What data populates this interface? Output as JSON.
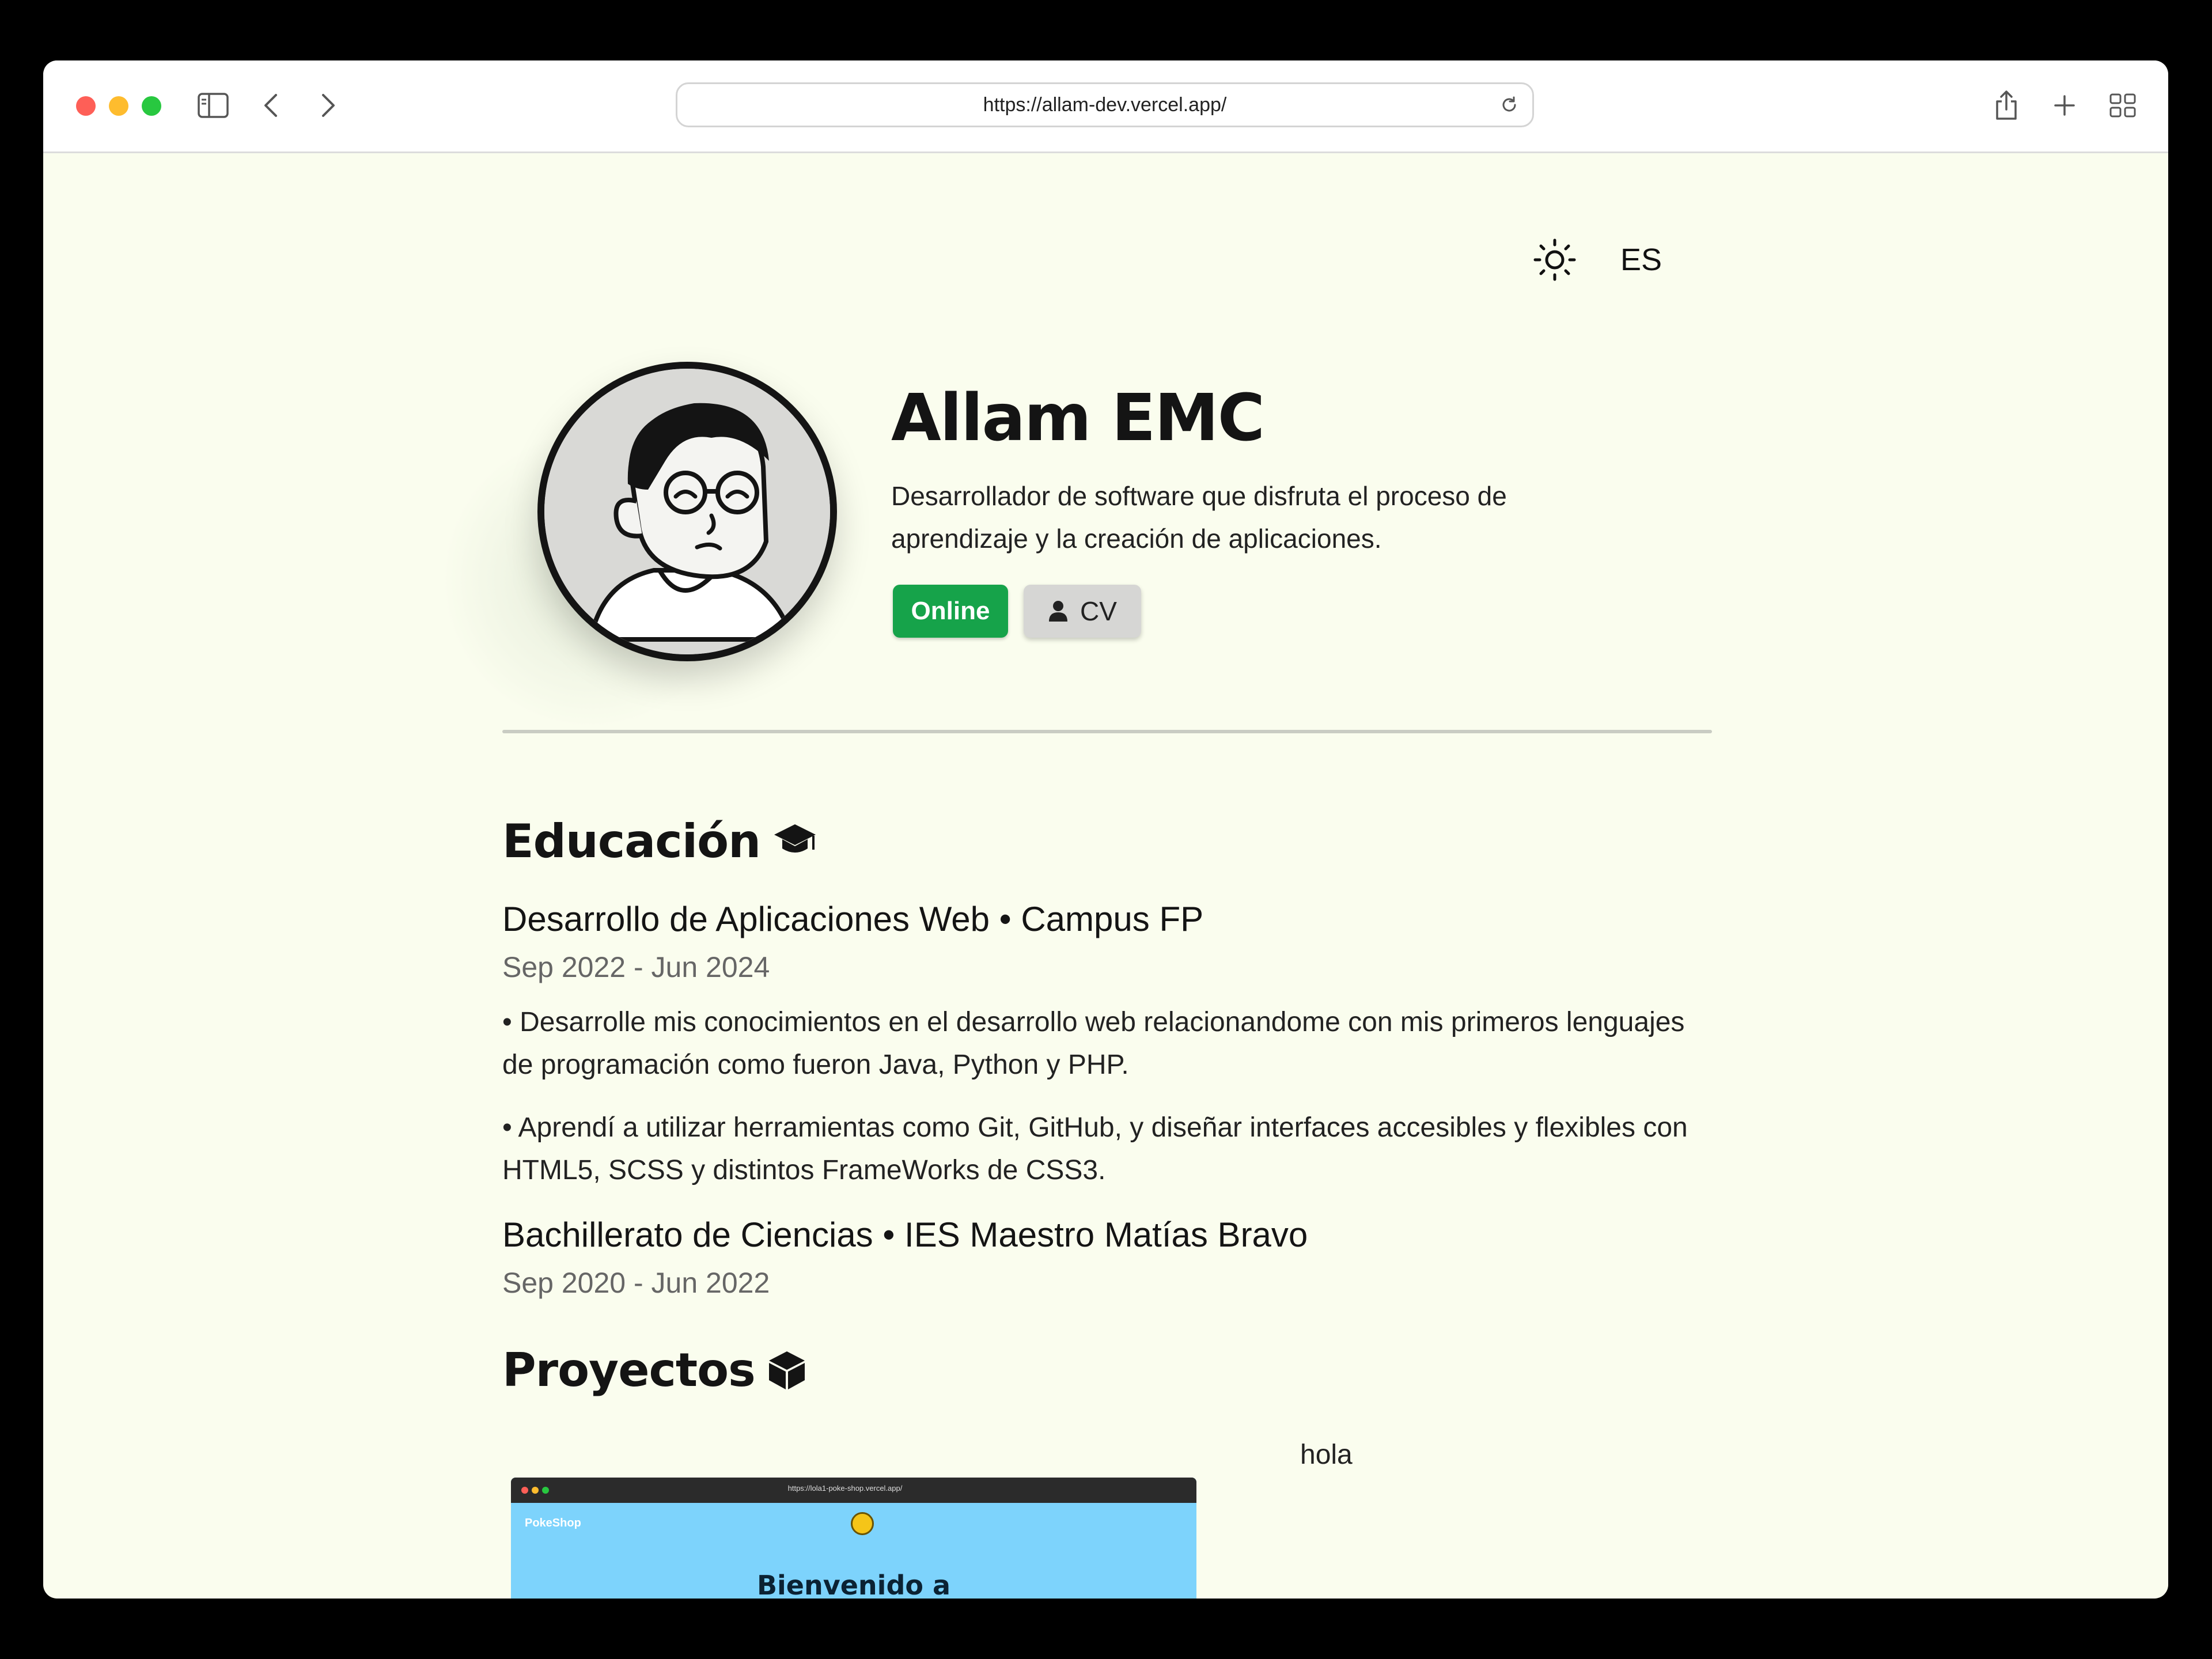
{
  "browser": {
    "url": "https://allam-dev.vercel.app/"
  },
  "header": {
    "language": "ES"
  },
  "profile": {
    "name": "Allam EMC",
    "tagline": "Desarrollador de software que disfruta el proceso de aprendizaje y la creación de aplicaciones.",
    "status": "Online",
    "cv_label": "CV"
  },
  "education": {
    "heading": "Educación",
    "items": [
      {
        "title": "Desarrollo de Aplicaciones Web • Campus FP",
        "dates": "Sep 2022 - Jun 2024",
        "bullets": [
          "• Desarrolle mis conocimientos en el desarrollo web relacionandome con mis primeros lenguajes de programación como fueron Java, Python y PHP.",
          "• Aprendí a utilizar herramientas como Git, GitHub, y diseñar interfaces accesibles y flexibles con HTML5, SCSS y distintos FrameWorks de CSS3."
        ]
      },
      {
        "title": "Bachillerato de Ciencias • IES Maestro Matías Bravo",
        "dates": "Sep 2020 - Jun 2022"
      }
    ]
  },
  "projects": {
    "heading": "Proyectos",
    "items": [
      {
        "title": "hola",
        "screenshot": {
          "url": "https://lola1-poke-shop.vercel.app/",
          "brand": "PokeShop",
          "welcome": "Bienvenido a"
        }
      }
    ]
  },
  "icons": {
    "education": "graduation-cap-icon",
    "projects": "cube-icon",
    "theme": "sun-icon",
    "cv": "user-icon"
  },
  "colors": {
    "page_background": "#fafdee",
    "status_online": "#16a34a",
    "cv_button": "#d6d6d4"
  }
}
